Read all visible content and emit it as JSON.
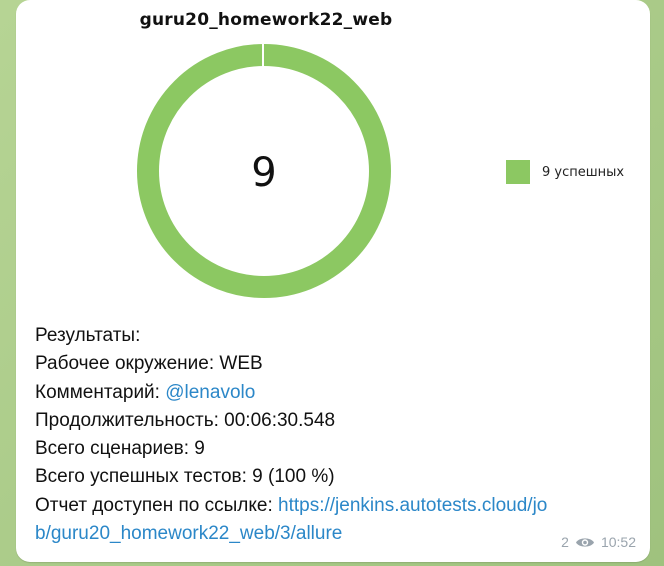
{
  "chart_data": {
    "type": "pie",
    "title": "guru20_homework22_web",
    "center_label": "9",
    "slices": [
      {
        "label": "9 успешных",
        "value": 9,
        "color": "#8cc862"
      }
    ],
    "legend_position": "right"
  },
  "message": {
    "results_heading": "Результаты:",
    "environment_label": "Рабочее окружение:",
    "environment_value": " WEB",
    "comment_label": "Комментарий:",
    "comment_value": "@lenavolo",
    "duration_label": "Продолжительность:",
    "duration_value": " 00:06:30.548",
    "total_label": "Всего сценариев:",
    "total_value": " 9",
    "passed_label": "Всего успешных тестов:",
    "passed_value": " 9 (100 %)",
    "report_label": "Отчет доступен по ссылке:",
    "report_link_line1": "https://jenkins.autotests.cloud/jo",
    "report_link_line2": "b/guru20_homework22_web/3/allure"
  },
  "meta": {
    "views": "2",
    "time": "10:52",
    "eye_icon": "eye-icon"
  }
}
